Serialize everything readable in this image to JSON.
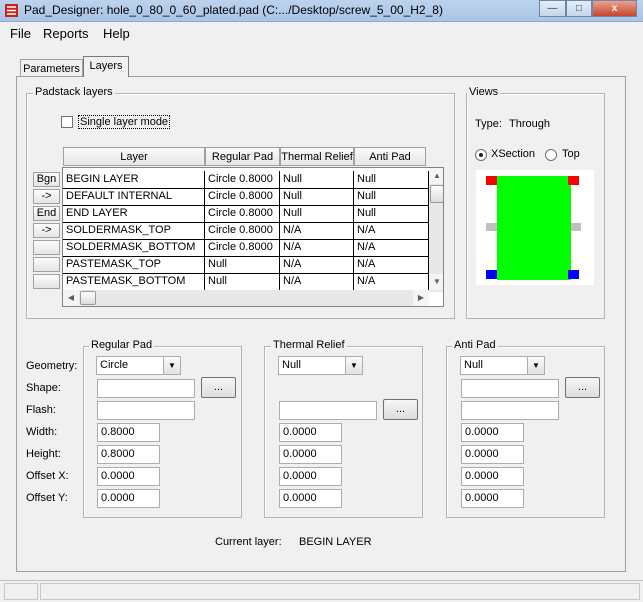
{
  "window": {
    "title": "Pad_Designer: hole_0_80_0_60_plated.pad (C:.../Desktop/screw_5_00_H2_8)",
    "btn_min": "—",
    "btn_max": "□",
    "btn_close": "x"
  },
  "menu": {
    "file": "File",
    "reports": "Reports",
    "help": "Help"
  },
  "tabs": {
    "parameters": "Parameters",
    "layers": "Layers"
  },
  "padstack": {
    "group_label": "Padstack layers",
    "single_layer_mode": "Single layer mode",
    "columns": [
      "Layer",
      "Regular Pad",
      "Thermal Relief",
      "Anti Pad"
    ],
    "row_buttons": [
      "Bgn",
      "->",
      "End",
      "->",
      "",
      "",
      ""
    ],
    "rows": [
      [
        "BEGIN LAYER",
        "Circle 0.8000",
        "Null",
        "Null"
      ],
      [
        "DEFAULT INTERNAL",
        "Circle 0.8000",
        "Null",
        "Null"
      ],
      [
        "END LAYER",
        "Circle 0.8000",
        "Null",
        "Null"
      ],
      [
        "SOLDERMASK_TOP",
        "Circle 0.8000",
        "N/A",
        "N/A"
      ],
      [
        "SOLDERMASK_BOTTOM",
        "Circle 0.8000",
        "N/A",
        "N/A"
      ],
      [
        "PASTEMASK_TOP",
        "Null",
        "N/A",
        "N/A"
      ],
      [
        "PASTEMASK_BOTTOM",
        "Null",
        "N/A",
        "N/A"
      ]
    ]
  },
  "views": {
    "group_label": "Views",
    "type_label": "Type:",
    "type_value": "Through",
    "xsection": "XSection",
    "top": "Top",
    "colors": {
      "pad": "#00ff00",
      "top_marker": "#ff0000",
      "bottom_marker": "#0000ff",
      "inner_marker": "#c0c0c0"
    }
  },
  "labels": {
    "geometry": "Geometry:",
    "shape": "Shape:",
    "flash": "Flash:",
    "width": "Width:",
    "height": "Height:",
    "offset_x": "Offset X:",
    "offset_y": "Offset Y:",
    "browse": "..."
  },
  "regular_pad": {
    "label": "Regular Pad",
    "geometry": "Circle",
    "shape": "",
    "flash": "",
    "width": "0.8000",
    "height": "0.8000",
    "offset_x": "0.0000",
    "offset_y": "0.0000"
  },
  "thermal_relief": {
    "label": "Thermal Relief",
    "geometry": "Null",
    "flash": "",
    "width": "0.0000",
    "height": "0.0000",
    "offset_x": "0.0000",
    "offset_y": "0.0000"
  },
  "anti_pad": {
    "label": "Anti Pad",
    "geometry": "Null",
    "shape": "",
    "flash": "",
    "width": "0.0000",
    "height": "0.0000",
    "offset_x": "0.0000",
    "offset_y": "0.0000"
  },
  "current_layer": {
    "label": "Current layer:",
    "value": "BEGIN LAYER"
  }
}
